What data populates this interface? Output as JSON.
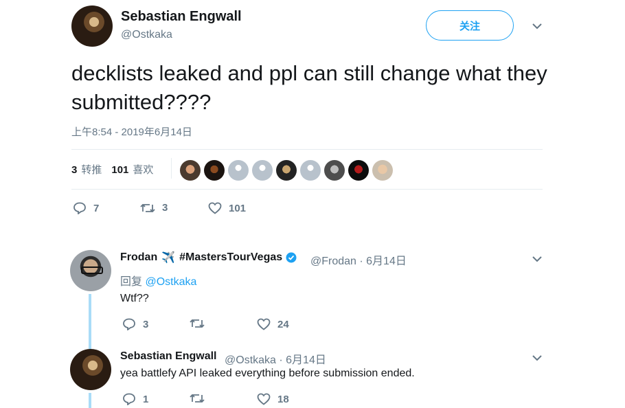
{
  "main_tweet": {
    "author_name": "Sebastian Engwall",
    "author_handle": "@Ostkaka",
    "follow_label": "关注",
    "text": "decklists leaked and ppl can still change what they submitted????",
    "timestamp": "上午8:54 - 2019年6月14日",
    "retweets_count": "3",
    "retweets_label": "转推",
    "likes_count": "101",
    "likes_label": "喜欢",
    "actions": {
      "replies": "7",
      "retweets": "3",
      "likes": "101"
    },
    "liker_avatars": [
      "avatar-1",
      "avatar-2",
      "default",
      "default",
      "avatar-5",
      "default",
      "avatar-7",
      "avatar-8",
      "avatar-9"
    ]
  },
  "replies": [
    {
      "author_name": "Frodan",
      "name_emoji": "✈️",
      "hashtag": "#MastersTourVegas",
      "verified": true,
      "handle": "@Frodan",
      "date": "6月14日",
      "reply_to_label": "回复",
      "reply_to_handle": "@Ostkaka",
      "text": "Wtf??",
      "actions": {
        "replies": "3",
        "retweets": "",
        "likes": "24"
      }
    },
    {
      "author_name": "Sebastian Engwall",
      "handle": "@Ostkaka",
      "date": "6月14日",
      "text": "yea battlefy API leaked everything before submission ended.",
      "actions": {
        "replies": "1",
        "retweets": "",
        "likes": "18"
      }
    }
  ],
  "colors": {
    "accent": "#1da1f2",
    "muted": "#657786",
    "thread": "#a9dcf7",
    "divider": "#e6ecf0"
  }
}
